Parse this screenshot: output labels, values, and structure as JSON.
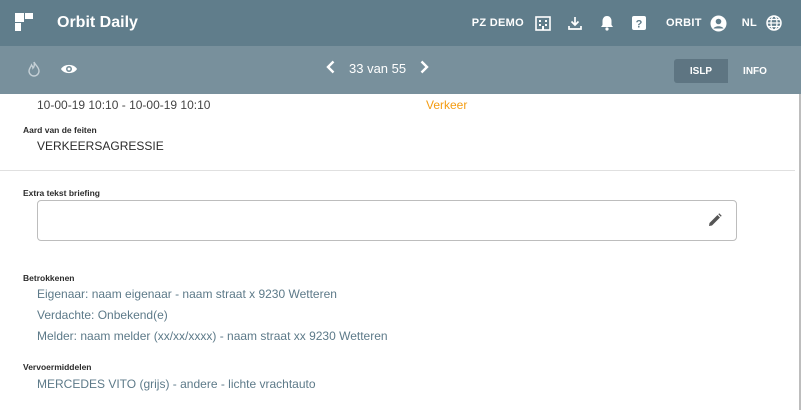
{
  "app": {
    "title": "Orbit Daily"
  },
  "topbar": {
    "zone": "PZ DEMO",
    "user": "ORBIT",
    "language": "NL"
  },
  "pager": {
    "text": "33 van 55"
  },
  "view_toggle": {
    "islp": "ISLP",
    "info": "INFO",
    "active": "ISLP"
  },
  "partial_row": {
    "time": "10-00-19 10:10 - 10-00-19 10:10",
    "category": "Verkeer"
  },
  "feiten": {
    "label": "Aard van de feiten",
    "value": "VERKEERSAGRESSIE"
  },
  "briefing": {
    "label": "Extra tekst briefing",
    "value": ""
  },
  "betrokkenen": {
    "label": "Betrokkenen",
    "items": [
      "Eigenaar: naam eigenaar - naam straat x 9230 Wetteren",
      "Verdachte: Onbekend(e)",
      "Melder: naam melder (xx/xx/xxxx) - naam straat xx 9230 Wetteren"
    ]
  },
  "vervoermiddelen": {
    "label": "Vervoermiddelen",
    "items": [
      "MERCEDES VITO (grijs) - andere - lichte vrachtauto"
    ]
  },
  "colors": {
    "header": "#607d8b",
    "toolbar": "#78909c",
    "accent_text": "#5d7a89",
    "category": "#f39c12"
  },
  "icons": [
    "app-grid-icon",
    "building-icon",
    "download-icon",
    "bell-icon",
    "help-icon",
    "account-icon",
    "globe-icon",
    "flame-icon",
    "eye-icon",
    "chevron-left-icon",
    "chevron-right-icon",
    "pencil-icon"
  ]
}
